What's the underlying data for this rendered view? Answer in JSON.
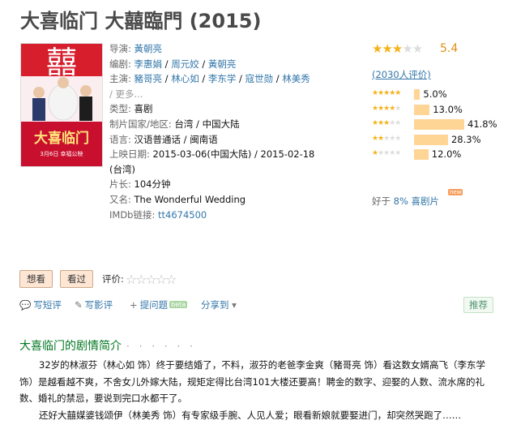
{
  "page_title": "大喜临门 大囍臨門 (2015)",
  "poster": {
    "heading": "囍",
    "title_text": "大喜临门",
    "date_text": "3月6日 幸福公映"
  },
  "info": {
    "director_label": "导演:",
    "director": "黃朝亮",
    "writer_label": "编剧:",
    "writers": [
      "李惠娟",
      "周元姣",
      "黃朝亮"
    ],
    "cast_label": "主演:",
    "cast": [
      "豬哥亮",
      "林心如",
      "李东学",
      "寇世勋",
      "林美秀"
    ],
    "cast_more": "/ 更多...",
    "genre_label": "类型:",
    "genre": "喜剧",
    "country_label": "制片国家/地区:",
    "country": "台湾 / 中国大陆",
    "language_label": "语言:",
    "language": "汉语普通话 / 闽南语",
    "release_label": "上映日期:",
    "release_line1": "2015-03-06(中国大陆) / 2015-02-18",
    "release_line2": "(台湾)",
    "runtime_label": "片长:",
    "runtime": "104分钟",
    "aka_label": "又名:",
    "aka": "The Wonderful Wedding",
    "imdb_label": "IMDb链接:",
    "imdb": "tt4674500"
  },
  "rating": {
    "score": "5.4",
    "stars_value": 2.5,
    "count_text": "(2030人评价)",
    "breakdown": [
      {
        "stars": 5,
        "percent": 5.0,
        "label": "5.0%"
      },
      {
        "stars": 4,
        "percent": 13.0,
        "label": "13.0%"
      },
      {
        "stars": 3,
        "percent": 41.8,
        "label": "41.8%"
      },
      {
        "stars": 2,
        "percent": 28.3,
        "label": "28.3%"
      },
      {
        "stars": 1,
        "percent": 12.0,
        "label": "12.0%"
      }
    ],
    "better_prefix": "好于",
    "better_link": "8% 喜剧片",
    "new_tag": "new"
  },
  "actions": {
    "want_label": "想看",
    "seen_label": "看过",
    "rate_label": "评价:"
  },
  "links": {
    "short_review": "写短评",
    "review": "写影评",
    "question": "提问题",
    "beta": "beta",
    "share": "分享到",
    "recommend": "推荐"
  },
  "synopsis": {
    "heading": "大喜临门的剧情简介",
    "dots": "· · · · · ·",
    "p1": "32岁的林淑芬（林心如 饰）终于要结婚了，不料，淑芬的老爸李金爽（豬哥亮 饰）看这数女婿高飞（李东学 饰）是越看越不爽，不舍女儿外嫁大陆，规矩定得比台湾101大楼还要高！聘金的数字、迎娶的人数、流水席的礼数、婚礼的禁忌，要说到完口水都干了。",
    "p2": "还好大囍媒婆钱颂伊（林美秀 饰）有专家级手腕、人见人爱；眼看新娘就要娶进门，却突然哭跑了……"
  },
  "colors": {
    "title": "#494949",
    "link": "#3377aa",
    "star": "#f5b31c",
    "bar": "#ffd596",
    "section_green": "#007722"
  }
}
